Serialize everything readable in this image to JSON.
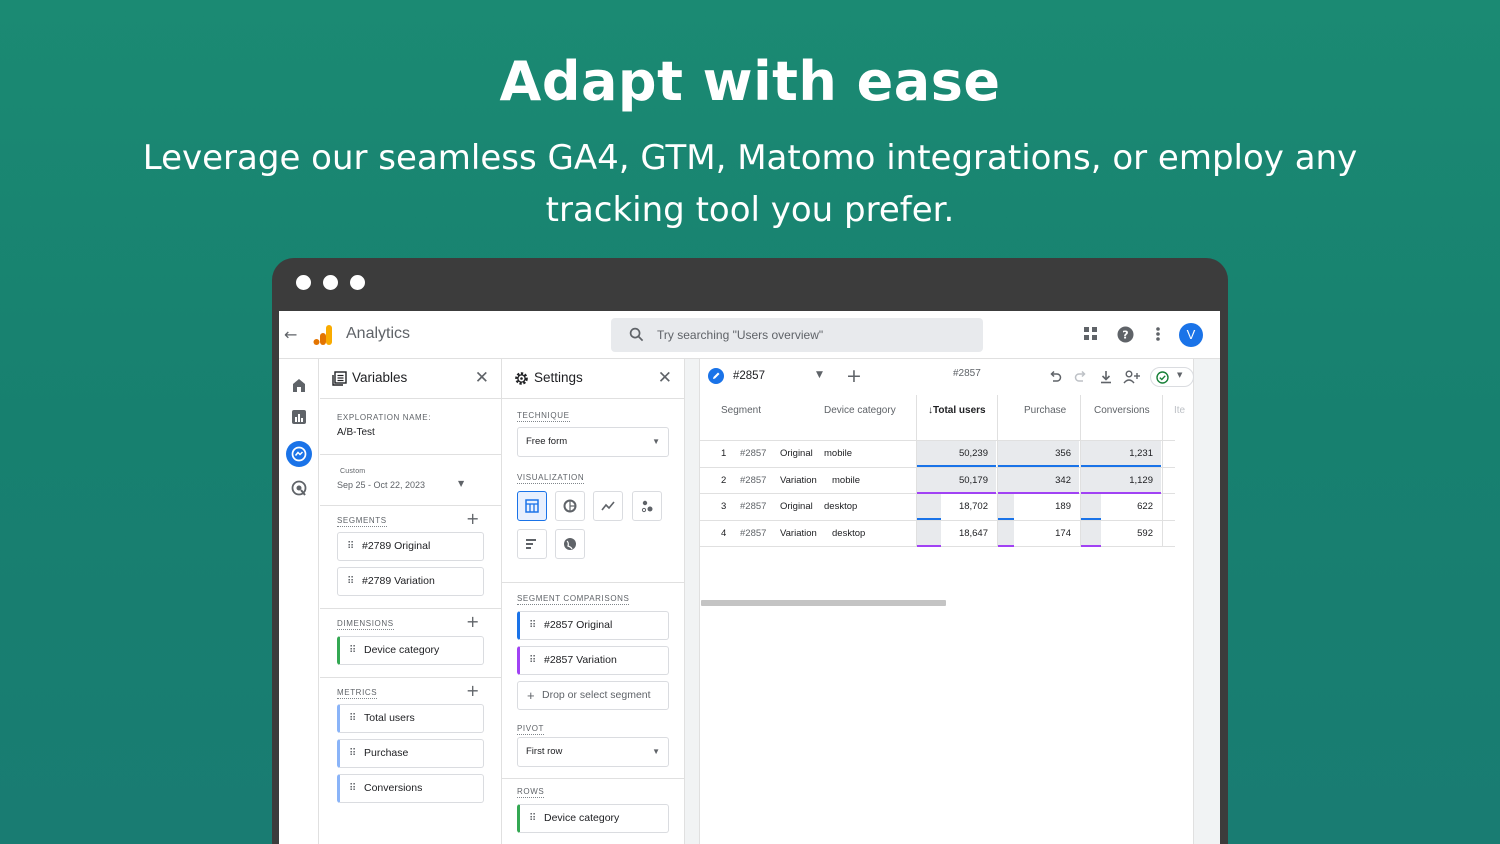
{
  "hero": {
    "title": "Adapt with ease",
    "subtitle": "Leverage our seamless GA4, GTM, Matomo integrations, or employ any tracking tool you prefer."
  },
  "app": {
    "title": "Analytics",
    "search_placeholder": "Try searching \"Users overview\"",
    "avatar_letter": "V"
  },
  "variables": {
    "header": "Variables",
    "exploration_name_label": "EXPLORATION NAME:",
    "exploration_name": "A/B-Test",
    "date_label": "Custom",
    "date_range": "Sep 25 - Oct 22, 2023",
    "segments_label": "SEGMENTS",
    "segments": [
      "#2789 Original",
      "#2789 Variation"
    ],
    "dimensions_label": "DIMENSIONS",
    "dimensions": [
      "Device category"
    ],
    "metrics_label": "METRICS",
    "metrics": [
      "Total users",
      "Purchase",
      "Conversions"
    ]
  },
  "settings": {
    "header": "Settings",
    "technique_label": "TECHNIQUE",
    "technique": "Free form",
    "visualization_label": "VISUALIZATION",
    "segment_comparisons_label": "SEGMENT COMPARISONS",
    "segment_comparisons": [
      "#2857 Original",
      "#2857 Variation"
    ],
    "drop_segment": "Drop or select segment",
    "pivot_label": "PIVOT",
    "pivot": "First row",
    "rows_label": "ROWS",
    "rows": [
      "Device category"
    ]
  },
  "canvas": {
    "tab_label": "#2857",
    "title": "#2857",
    "columns": [
      "Segment",
      "Device category",
      "Total users",
      "Purchase",
      "Conversions",
      "Ite"
    ],
    "rows": [
      {
        "index": "1",
        "segment": "#2857",
        "variant": "Original",
        "device": "mobile",
        "total_users": "50,239",
        "purchase": "356",
        "conversions": "1,231"
      },
      {
        "index": "2",
        "segment": "#2857",
        "variant": "Variation",
        "device": "mobile",
        "total_users": "50,179",
        "purchase": "342",
        "conversions": "1,129"
      },
      {
        "index": "3",
        "segment": "#2857",
        "variant": "Original",
        "device": "desktop",
        "total_users": "18,702",
        "purchase": "189",
        "conversions": "622"
      },
      {
        "index": "4",
        "segment": "#2857",
        "variant": "Variation",
        "device": "desktop",
        "total_users": "18,647",
        "purchase": "174",
        "conversions": "592"
      }
    ],
    "row_bar_fraction": {
      "total_users": [
        1.0,
        1.0,
        0.3,
        0.3
      ],
      "purchase": [
        1.0,
        1.0,
        0.2,
        0.2
      ],
      "conversions": [
        1.0,
        1.0,
        0.25,
        0.25
      ]
    }
  },
  "colors": {
    "brand_green": "#1b8a73",
    "accent_blue": "#1a73e8",
    "original_blue": "#1a73e8",
    "variation_purple": "#a142f4",
    "dimension_green": "#34a853"
  }
}
